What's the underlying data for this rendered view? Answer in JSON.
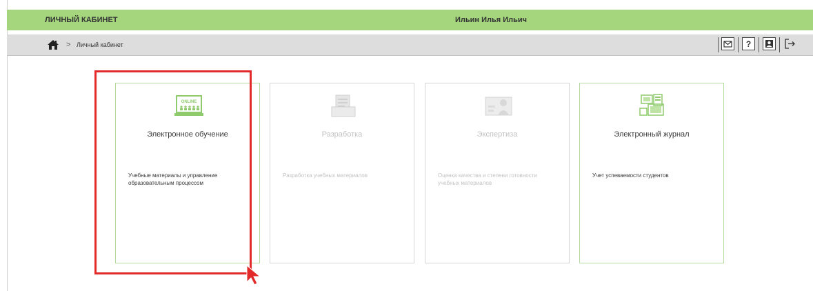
{
  "header": {
    "title": "ЛИЧНЫЙ КАБИНЕТ",
    "user_name": "Ильин Илья Ильич"
  },
  "breadcrumb": {
    "separator": ">",
    "current": "Личный кабинет"
  },
  "toolbar": {
    "icons": [
      "mail-icon",
      "help-icon",
      "profile-icon",
      "logout-icon"
    ]
  },
  "cards": [
    {
      "title": "Электронное обучение",
      "description": "Учебные материалы и управление образовательным процессом",
      "icon": "online-laptop-icon",
      "icon_text": "ONLINE",
      "enabled": true,
      "highlighted": true
    },
    {
      "title": "Разработка",
      "description": "Разработка учебных материалов",
      "icon": "development-icon",
      "enabled": false
    },
    {
      "title": "Экспертиза",
      "description": "Оценка качества и степени готовности учебных материалов",
      "icon": "expertise-icon",
      "enabled": false
    },
    {
      "title": "Электронный журнал",
      "description": "Учет успеваемости студентов",
      "icon": "e-journal-icon",
      "enabled": true
    }
  ],
  "colors": {
    "header_green": "#a5d67e",
    "breadcrumb_gray": "#dddddd",
    "card_active_border": "#b6dba0",
    "highlight_red": "#e22a2a",
    "icon_green": "#8fcb6c",
    "disabled_text": "#c2c2c2"
  }
}
